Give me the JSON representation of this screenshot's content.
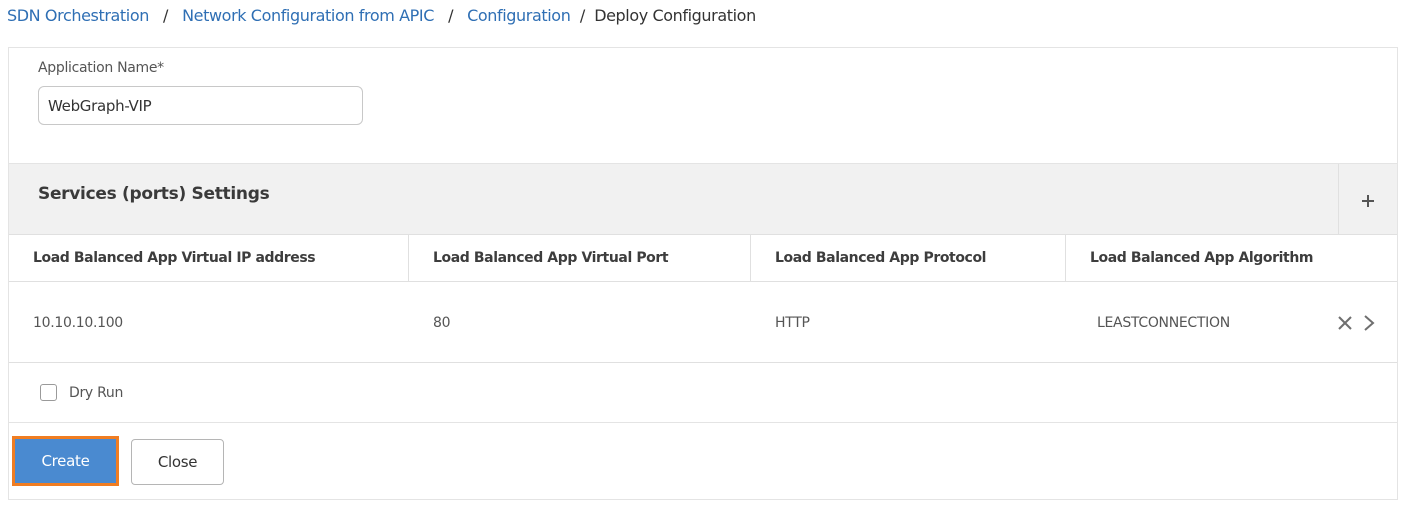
{
  "breadcrumb": {
    "items": [
      "SDN Orchestration",
      "Network Configuration from APIC",
      "Configuration"
    ],
    "current": "Deploy Configuration",
    "separator": "/"
  },
  "form": {
    "app_name_label": "Application Name*",
    "app_name_value": "WebGraph-VIP"
  },
  "services": {
    "title": "Services (ports) Settings",
    "add_icon": "plus-icon",
    "columns": [
      "Load Balanced App Virtual IP address",
      "Load Balanced App Virtual Port",
      "Load Balanced App Protocol",
      "Load Balanced App Algorithm"
    ],
    "rows": [
      {
        "vip": "10.10.10.100",
        "port": "80",
        "protocol": "HTTP",
        "algorithm": "LEASTCONNECTION",
        "actions": [
          "close-icon",
          "chevron-right-icon"
        ]
      }
    ]
  },
  "dry_run": {
    "label": "Dry Run",
    "checked": false
  },
  "buttons": {
    "create": "Create",
    "close": "Close"
  },
  "colors": {
    "link": "#2f6fb4",
    "primary_button": "#4a8ad0",
    "focus_outline": "#f07d22",
    "section_header_bg": "#f1f1f1"
  }
}
